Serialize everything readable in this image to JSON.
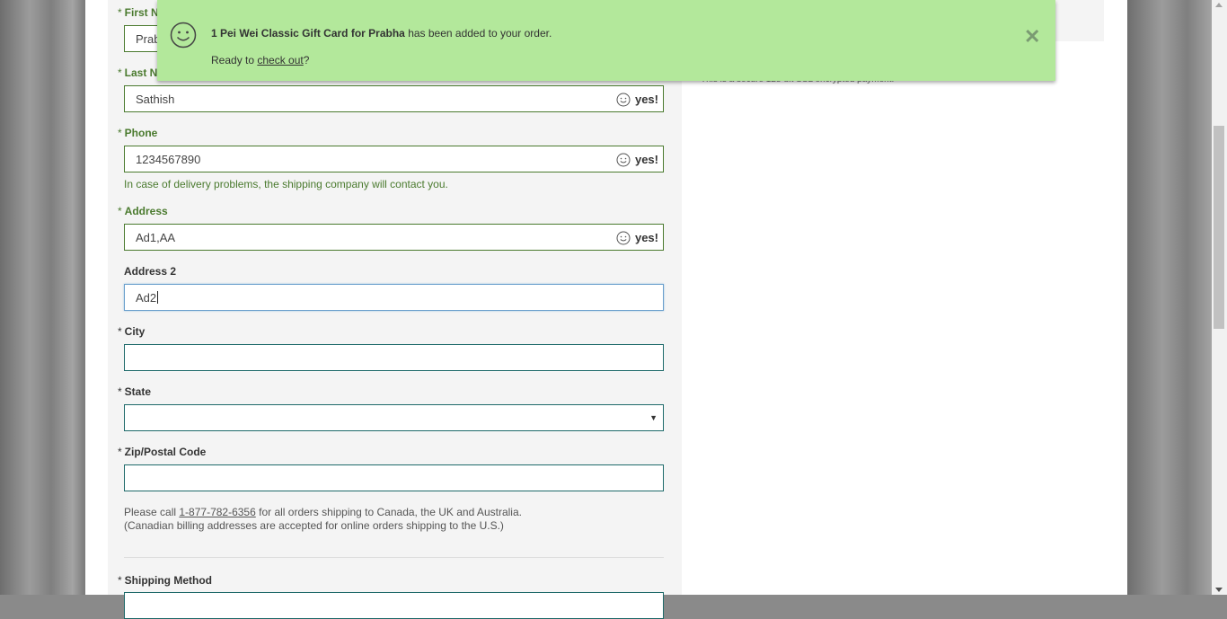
{
  "form": {
    "first_name": {
      "label": "First N",
      "value": "Prab",
      "required_mark": "*"
    },
    "last_name": {
      "label": "Last N",
      "value": "Sathish",
      "required_mark": "*",
      "status": "yes!"
    },
    "phone": {
      "label": "Phone",
      "value": "1234567890",
      "required_mark": "*",
      "status": "yes!",
      "hint": "In case of delivery problems, the shipping company will contact you."
    },
    "address": {
      "label": "Address",
      "value": "Ad1,AA",
      "required_mark": "*",
      "status": "yes!"
    },
    "address2": {
      "label": "Address 2",
      "value": "Ad2"
    },
    "city": {
      "label": "City",
      "value": "",
      "required_mark": "*"
    },
    "state": {
      "label": "State",
      "value": "",
      "required_mark": "*"
    },
    "zip": {
      "label": "Zip/Postal Code",
      "value": "",
      "required_mark": "*"
    },
    "shipping_note": {
      "prefix": "Please call ",
      "phone_link": "1-877-782-6356",
      "suffix": " for all orders shipping to Canada, the UK and Australia.",
      "line2": "(Canadian billing addresses are accepted for online orders shipping to the U.S.)"
    },
    "shipping_method": {
      "label": "Shipping Method",
      "required_mark": "*"
    }
  },
  "summary": {
    "secure_text": "This is a secure 128-bit SSL encrypted payment."
  },
  "toast": {
    "item": "1 Pei Wei Classic Gift Card for Prabha",
    "message": " has been added to your order.",
    "ready_prefix": "Ready to ",
    "checkout_link": "check out",
    "ready_suffix": "?",
    "close_symbol": "✕",
    "background": "#b3e89b"
  },
  "colors": {
    "valid": "#4a7a2e",
    "field_border": "#1e6a6a",
    "focus_border": "#6a9fcc"
  }
}
